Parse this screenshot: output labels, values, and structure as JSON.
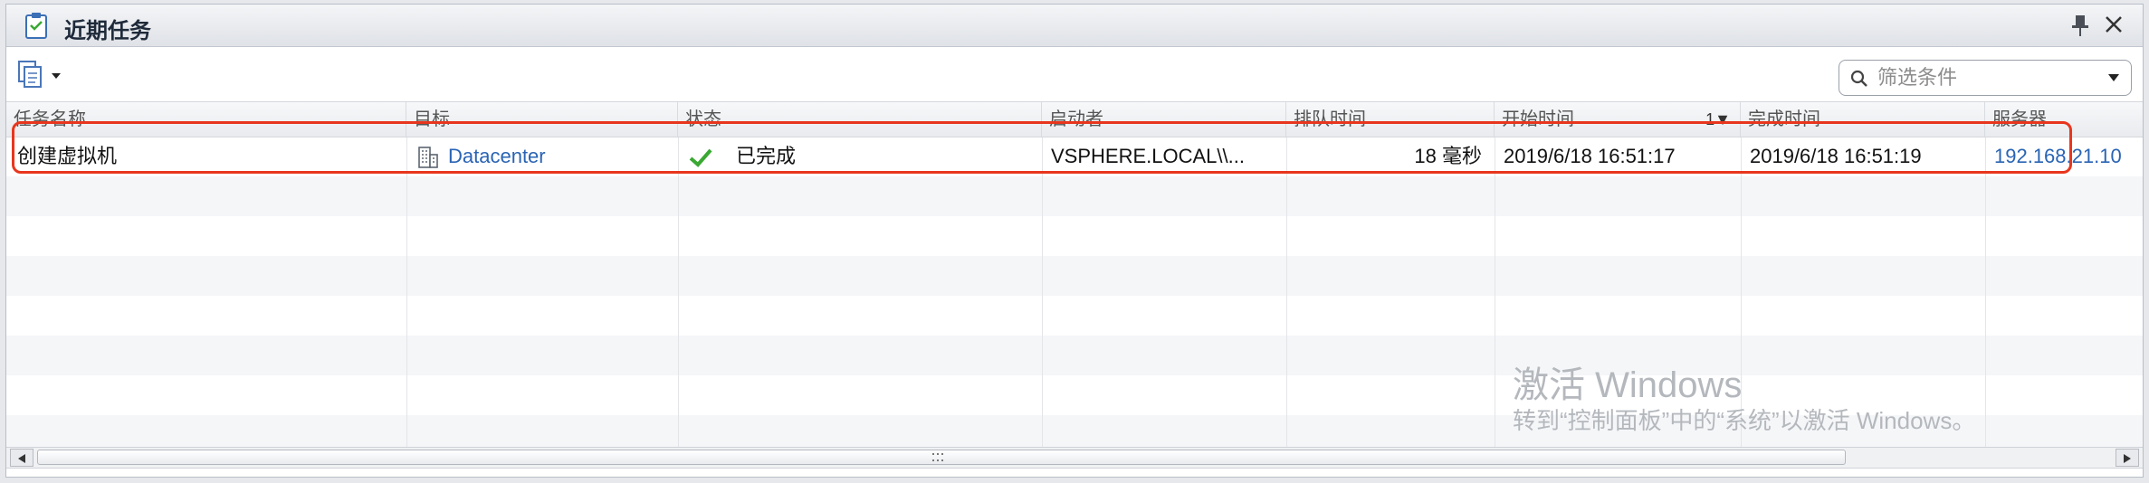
{
  "panel": {
    "title": "近期任务"
  },
  "toolbar": {
    "filter_placeholder": "筛选条件"
  },
  "columns": [
    {
      "label": "任务名称"
    },
    {
      "label": "目标"
    },
    {
      "label": "状态"
    },
    {
      "label": "启动者"
    },
    {
      "label": "排队时间"
    },
    {
      "label": "开始时间",
      "sort_indicator": "1▼"
    },
    {
      "label": "完成时间"
    },
    {
      "label": "服务器"
    }
  ],
  "rows": [
    {
      "task_name": "创建虚拟机",
      "target": "Datacenter",
      "status": "已完成",
      "initiator": "VSPHERE.LOCAL\\\\...",
      "queued_for": "18 毫秒",
      "start_time": "2019/6/18 16:51:17",
      "completion_time": "2019/6/18 16:51:19",
      "server": "192.168.21.10"
    }
  ],
  "watermark": {
    "title": "激活 Windows",
    "subtitle": "转到“控制面板”中的“系统”以激活 Windows。"
  },
  "colors": {
    "highlight": "#e8361d",
    "link": "#2a64b4",
    "success": "#3aa832"
  }
}
